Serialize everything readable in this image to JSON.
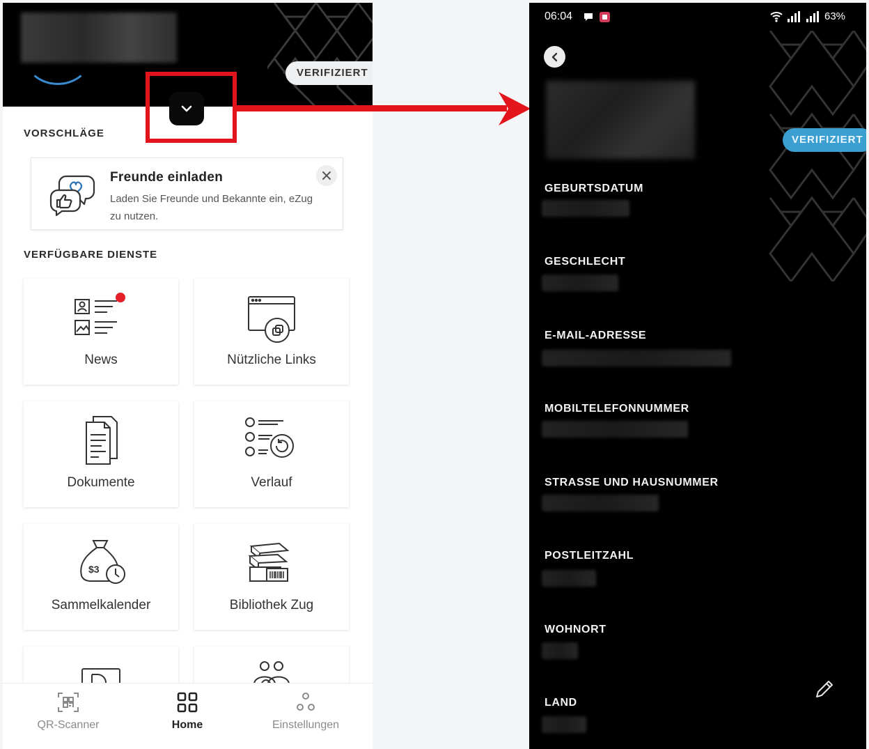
{
  "left_screen": {
    "header": {
      "badge": "VERIFIZIERT"
    },
    "sections": {
      "suggestions_title": "VORSCHLÄGE",
      "services_title": "VERFÜGBARE DIENSTE"
    },
    "suggestion_card": {
      "title": "Freunde einladen",
      "text": "Laden Sie Freunde und Bekannte ein, eZug zu nutzen.",
      "close_icon": "close-icon"
    },
    "services": [
      {
        "label": "News",
        "icon": "news-icon",
        "has_notification": true
      },
      {
        "label": "Nützliche Links",
        "icon": "browser-link-icon"
      },
      {
        "label": "Dokumente",
        "icon": "document-icon"
      },
      {
        "label": "Verlauf",
        "icon": "history-list-icon"
      },
      {
        "label": "Sammelkalender",
        "icon": "money-bag-clock-icon"
      },
      {
        "label": "Bibliothek Zug",
        "icon": "books-icon"
      }
    ],
    "bottom_nav": [
      {
        "label": "QR-Scanner",
        "icon": "qr-code-icon",
        "active": false
      },
      {
        "label": "Home",
        "icon": "grid-icon",
        "active": true
      },
      {
        "label": "Einstellungen",
        "icon": "settings-nodes-icon",
        "active": false
      }
    ]
  },
  "right_screen": {
    "status_bar": {
      "time": "06:04",
      "battery": "63%"
    },
    "badge": "VERIFIZIERT",
    "fields": [
      {
        "label": "GEBURTSDATUM"
      },
      {
        "label": "GESCHLECHT"
      },
      {
        "label": "E-MAIL-ADRESSE"
      },
      {
        "label": "MOBILTELEFONNUMMER"
      },
      {
        "label": "STRASSE UND HAUSNUMMER"
      },
      {
        "label": "POSTLEITZAHL"
      },
      {
        "label": "WOHNORT"
      },
      {
        "label": "LAND"
      }
    ]
  },
  "colors": {
    "annotation_red": "#e3141b",
    "verified_blue": "#3b9fd1",
    "notification_red": "#e3202a"
  }
}
